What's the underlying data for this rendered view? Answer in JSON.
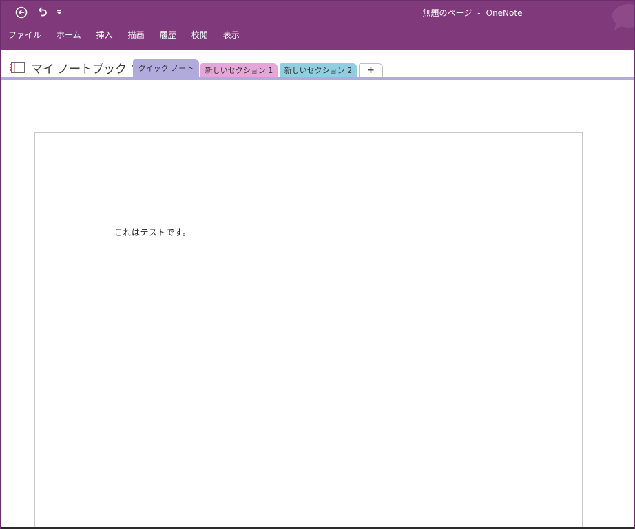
{
  "app": {
    "page_title": "無題のページ",
    "separator": "-",
    "app_name": "OneNote",
    "accent_color": "#80397b"
  },
  "quick_access": {
    "back_icon": "back-circle-arrow-icon",
    "undo_icon": "undo-arrow-icon",
    "customize_icon": "customize-qat-icon"
  },
  "ribbon": {
    "tabs": [
      "ファイル",
      "ホーム",
      "挿入",
      "描画",
      "履歴",
      "校閲",
      "表示"
    ]
  },
  "notebook": {
    "name": "マイ ノートブック",
    "icon": "notebook-icon"
  },
  "sections": [
    {
      "label": "クイック ノート",
      "color": "#b1abdd",
      "active": true
    },
    {
      "label": "新しいセクション 1",
      "color": "#e3a7d8",
      "active": false
    },
    {
      "label": "新しいセクション 2",
      "color": "#91cfe0",
      "active": false
    }
  ],
  "add_section": {
    "label": "+"
  },
  "page": {
    "body_text": "これはテストです。"
  }
}
